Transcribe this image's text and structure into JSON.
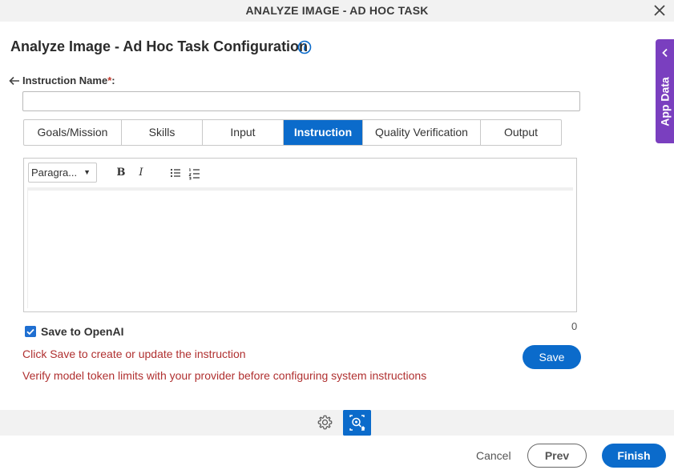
{
  "dialog": {
    "title": "ANALYZE IMAGE - AD HOC TASK"
  },
  "page": {
    "title": "Analyze Image - Ad Hoc Task Configuration"
  },
  "form": {
    "instruction_name_label": "Instruction Name",
    "required_mark": "*",
    "label_colon": ":",
    "instruction_name_value": "",
    "instruction_name_placeholder": ""
  },
  "tabs": [
    {
      "label": "Goals/Mission",
      "active": false
    },
    {
      "label": "Skills",
      "active": false
    },
    {
      "label": "Input",
      "active": false
    },
    {
      "label": "Instruction",
      "active": true
    },
    {
      "label": "Quality Verification",
      "active": false
    },
    {
      "label": "Output",
      "active": false
    }
  ],
  "editor": {
    "paragraph_select": "Paragra...",
    "bold": "B",
    "italic": "I",
    "content": ""
  },
  "save_to_openai": {
    "label": "Save to OpenAI",
    "checked": true
  },
  "char_count": "0",
  "messages": {
    "save_hint": "Click Save to create or update the instruction",
    "token_warning": "Verify model token limits with your provider before configuring system instructions"
  },
  "buttons": {
    "save": "Save",
    "cancel": "Cancel",
    "prev": "Prev",
    "finish": "Finish"
  },
  "side_panel": {
    "label": "App Data"
  },
  "icons": {
    "close": "close-icon",
    "info": "info-icon",
    "back": "arrow-left-icon",
    "gear": "gear-icon",
    "ai": "ai-image-icon",
    "chevron": "chevron-left-icon"
  },
  "colors": {
    "accent": "#0b6bcb",
    "side_panel": "#7a3fbf",
    "warning_text": "#b03030"
  }
}
